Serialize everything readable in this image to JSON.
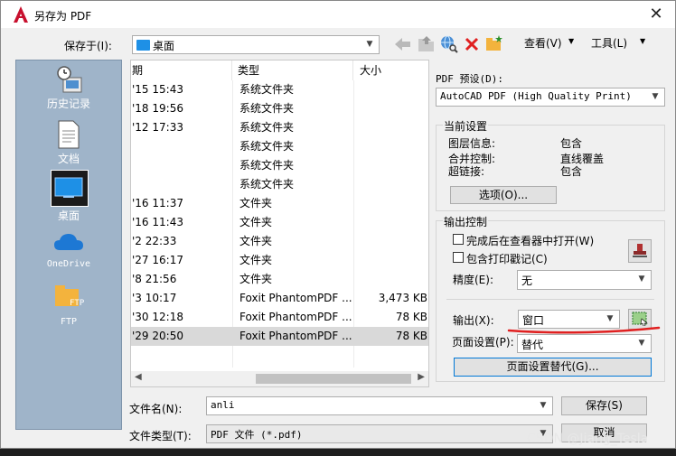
{
  "window": {
    "title": "另存为 PDF",
    "close": "✕"
  },
  "save_in": {
    "label": "保存于(I):",
    "value": "桌面"
  },
  "toolbar": {
    "view_label": "查看(V)",
    "tools_label": "工具(L)"
  },
  "places": [
    {
      "label": "历史记录"
    },
    {
      "label": "文档"
    },
    {
      "label": "桌面"
    },
    {
      "label": "OneDrive"
    },
    {
      "label": "FTP"
    }
  ],
  "places_ftp_badge": "FTP",
  "file_list": {
    "columns": [
      {
        "label": "期"
      },
      {
        "label": "类型"
      },
      {
        "label": "大小"
      }
    ],
    "rows": [
      {
        "date": "'15 15:43",
        "type": "系统文件夹",
        "size": ""
      },
      {
        "date": "'18 19:56",
        "type": "系统文件夹",
        "size": ""
      },
      {
        "date": "'12 17:33",
        "type": "系统文件夹",
        "size": ""
      },
      {
        "date": "",
        "type": "系统文件夹",
        "size": ""
      },
      {
        "date": "",
        "type": "系统文件夹",
        "size": ""
      },
      {
        "date": "",
        "type": "系统文件夹",
        "size": ""
      },
      {
        "date": "'16 11:37",
        "type": "文件夹",
        "size": ""
      },
      {
        "date": "'16 11:43",
        "type": "文件夹",
        "size": ""
      },
      {
        "date": "'2 22:33",
        "type": "文件夹",
        "size": ""
      },
      {
        "date": "'27 16:17",
        "type": "文件夹",
        "size": ""
      },
      {
        "date": "'8 21:56",
        "type": "文件夹",
        "size": ""
      },
      {
        "date": "'3 10:17",
        "type": "Foxit PhantomPDF ...",
        "size": "3,473 KB"
      },
      {
        "date": "'30 12:18",
        "type": "Foxit PhantomPDF ...",
        "size": "78 KB"
      },
      {
        "date": "'29 20:50",
        "type": "Foxit PhantomPDF ...",
        "size": "78 KB"
      }
    ]
  },
  "filename": {
    "label": "文件名(N):",
    "value": "anli"
  },
  "filetype": {
    "label": "文件类型(T):",
    "value": "PDF 文件 (*.pdf)"
  },
  "buttons": {
    "save": "保存(S)",
    "cancel": "取消"
  },
  "pdf_preset": {
    "label": "PDF 预设(D):",
    "value": "AutoCAD PDF (High Quality Print)"
  },
  "current_settings": {
    "title": "当前设置",
    "rows": [
      {
        "key": "图层信息:",
        "value": "包含"
      },
      {
        "key": "合并控制:",
        "value": "直线覆盖"
      },
      {
        "key": "超链接:",
        "value": "包含"
      }
    ],
    "options_button": "选项(O)..."
  },
  "output_control": {
    "title": "输出控制",
    "open_in_viewer": "完成后在查看器中打开(W)",
    "include_stamp": "包含打印戳记(C)",
    "precision_label": "精度(E):",
    "precision_value": "无",
    "output_label": "输出(X):",
    "output_value": "窗口",
    "page_setup_label": "页面设置(P):",
    "page_setup_value": "替代",
    "page_setup_override_button": "页面设置替代(G)..."
  },
  "watermark": "CSDN @Jiang_Tesla",
  "colors": {
    "accent": "#0078d7",
    "annotation_red": "#e02020"
  }
}
